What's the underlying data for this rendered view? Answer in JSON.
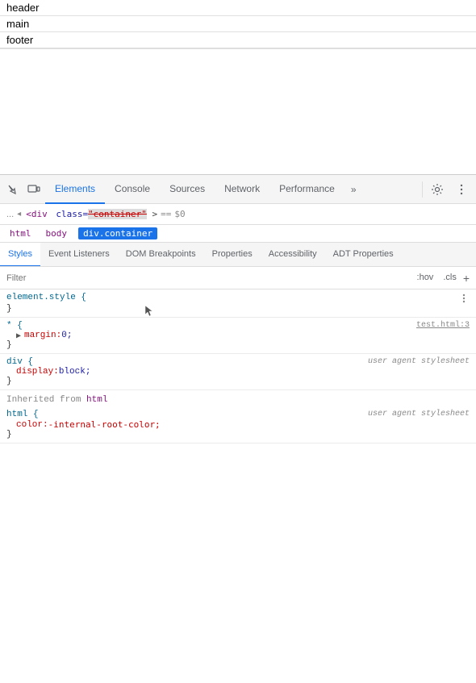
{
  "page": {
    "items": [
      {
        "label": "header"
      },
      {
        "label": "main"
      },
      {
        "label": "footer"
      }
    ]
  },
  "devtools": {
    "tabs": [
      {
        "label": "Elements",
        "active": true
      },
      {
        "label": "Console",
        "active": false
      },
      {
        "label": "Sources",
        "active": false
      },
      {
        "label": "Network",
        "active": false
      },
      {
        "label": "Performance",
        "active": false
      }
    ],
    "more_icon": "»",
    "breadcrumb": {
      "parts": [
        "html",
        "body",
        "div.container"
      ]
    },
    "subtabs": [
      {
        "label": "Styles",
        "active": true
      },
      {
        "label": "Event Listeners",
        "active": false
      },
      {
        "label": "DOM Breakpoints",
        "active": false
      },
      {
        "label": "Properties",
        "active": false
      },
      {
        "label": "Accessibility",
        "active": false
      },
      {
        "label": "ADT Properties",
        "active": false
      }
    ],
    "filter": {
      "placeholder": "Filter",
      "hov_label": ":hov",
      "cls_label": ".cls",
      "add_label": "+"
    },
    "rules": [
      {
        "selector": "element.style {",
        "close": "}",
        "properties": [],
        "source": null
      },
      {
        "selector": "* {",
        "close": "}",
        "properties": [
          {
            "name": "margin:",
            "arrow": true,
            "value": " 0;"
          }
        ],
        "source": "test.html:3"
      },
      {
        "selector": "div {",
        "close": "}",
        "properties": [
          {
            "name": "display:",
            "arrow": false,
            "value": " block;"
          }
        ],
        "source": null,
        "user_agent": "user agent stylesheet"
      }
    ],
    "inherited": {
      "label": "Inherited from ",
      "tag": "html"
    },
    "inherited_rules": [
      {
        "selector": "html {",
        "close": "}",
        "properties": [
          {
            "name": "color:",
            "arrow": false,
            "value": " -internal-root-color;"
          }
        ],
        "source": null,
        "user_agent": "user agent stylesheet"
      }
    ]
  }
}
